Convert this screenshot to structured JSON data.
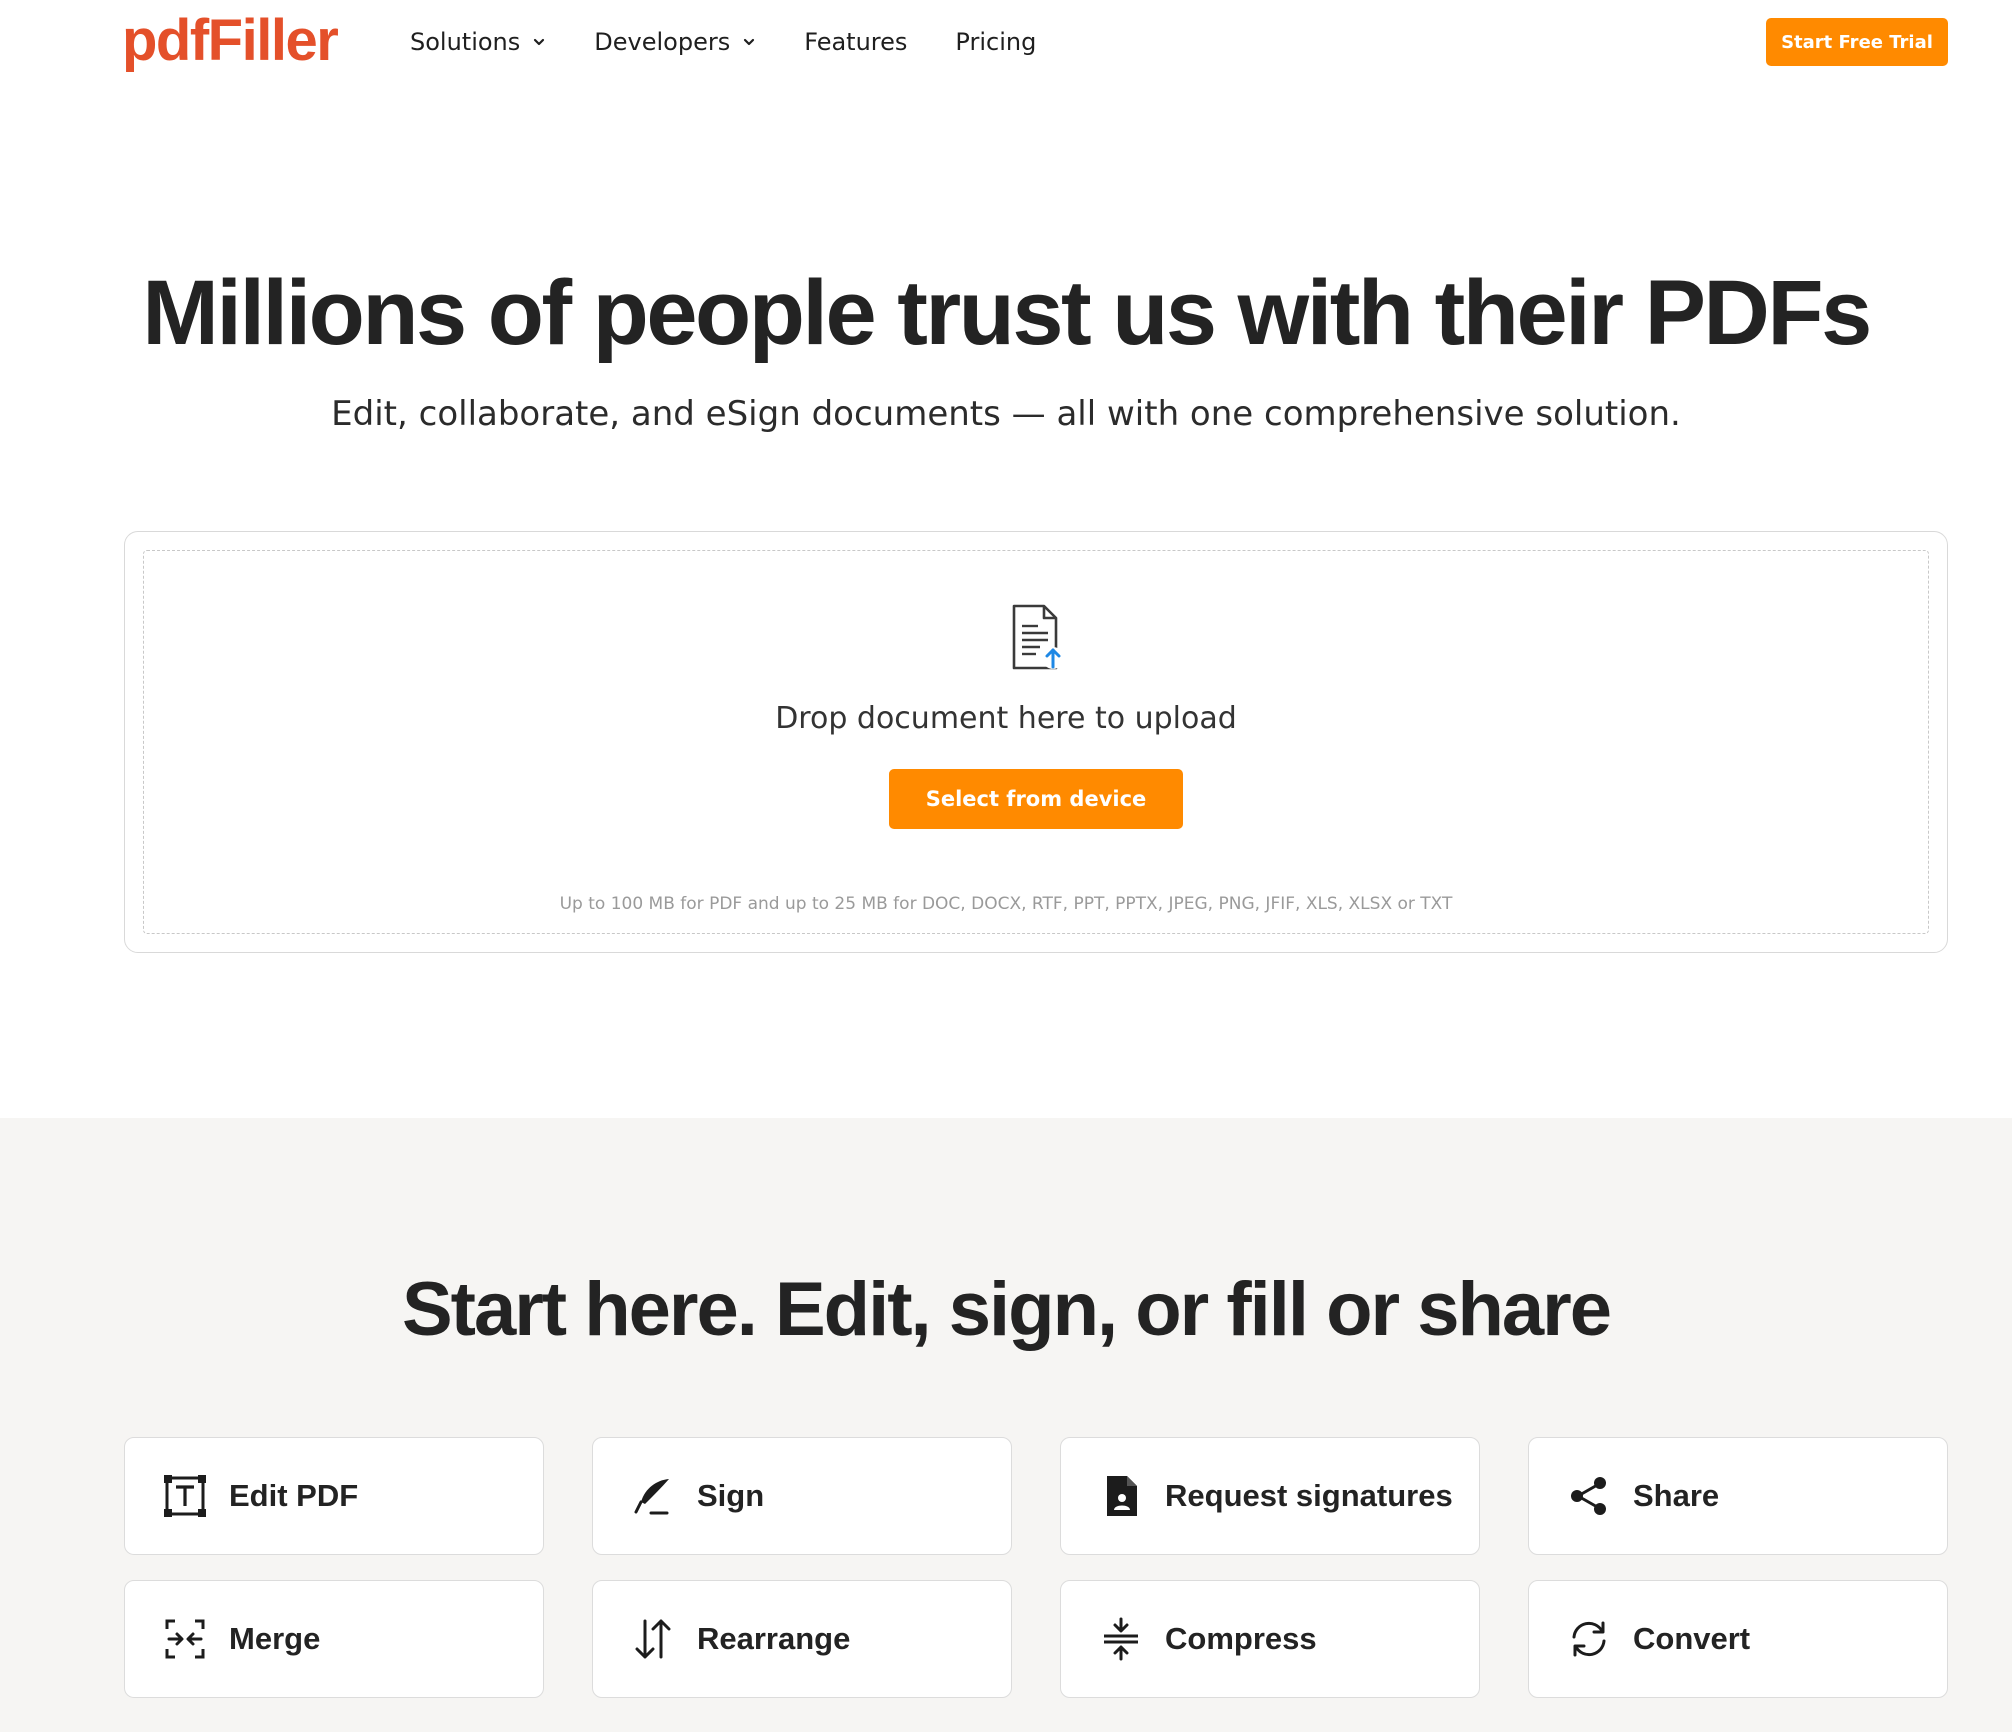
{
  "brand": {
    "logo_text": "pdfFiller",
    "accent_color": "#e4502a",
    "button_color": "#ff8a00"
  },
  "nav": {
    "items": [
      {
        "label": "Solutions",
        "has_dropdown": true
      },
      {
        "label": "Developers",
        "has_dropdown": true
      },
      {
        "label": "Features",
        "has_dropdown": false
      },
      {
        "label": "Pricing",
        "has_dropdown": false
      }
    ],
    "cta_label": "Start Free Trial"
  },
  "hero": {
    "title": "Millions of people trust us with their PDFs",
    "subtitle": "Edit, collaborate, and eSign documents — all with one comprehensive solution."
  },
  "upload": {
    "icon": "document-upload-icon",
    "drop_text": "Drop document here to upload",
    "button_label": "Select from device",
    "limits_text": "Up to 100 MB for PDF and up to 25 MB for DOC, DOCX, RTF, PPT, PPTX, JPEG, PNG, JFIF, XLS, XLSX or TXT"
  },
  "tools": {
    "title": "Start here. Edit, sign, or fill or share",
    "items": [
      {
        "label": "Edit PDF",
        "icon": "text-edit-icon"
      },
      {
        "label": "Sign",
        "icon": "pen-nib-icon"
      },
      {
        "label": "Request signatures",
        "icon": "signature-request-icon"
      },
      {
        "label": "Share",
        "icon": "share-icon"
      },
      {
        "label": "Merge",
        "icon": "merge-icon"
      },
      {
        "label": "Rearrange",
        "icon": "rearrange-arrows-icon"
      },
      {
        "label": "Compress",
        "icon": "compress-icon"
      },
      {
        "label": "Convert",
        "icon": "convert-arrows-icon"
      }
    ]
  }
}
